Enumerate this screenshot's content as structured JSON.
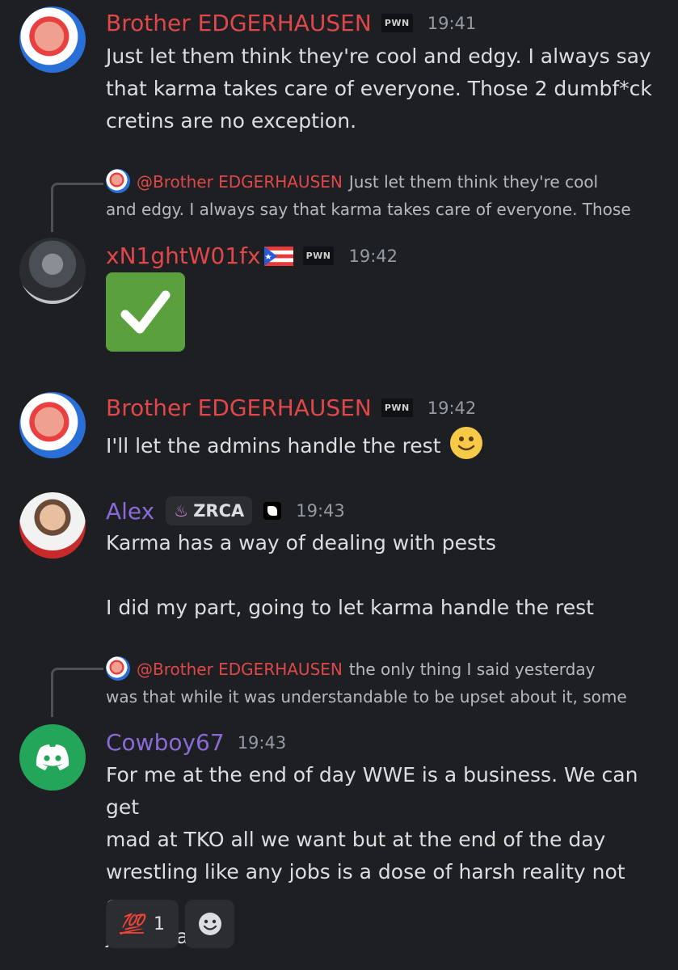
{
  "messages": [
    {
      "author": "Brother EDGERHAUSEN",
      "badge": "PWN",
      "time": "19:41",
      "lines": [
        "Just let them think they're cool and edgy. I always say",
        "that karma takes care of everyone. Those 2 dumbf*ck",
        "cretins are no exception."
      ]
    },
    {
      "reply": {
        "mention": "@Brother EDGERHAUSEN",
        "line1": "Just let them think they're cool",
        "line2": "and edgy. I always say that karma takes care of everyone. Those"
      },
      "author": "xN1ghtW01fx",
      "badge": "PWN",
      "time": "19:42",
      "content_icon": "green-checkmark-emoji"
    },
    {
      "author": "Brother EDGERHAUSEN",
      "badge": "PWN",
      "time": "19:42",
      "text": "I'll let the admins handle the rest"
    },
    {
      "author": "Alex",
      "tag": "ZRCA",
      "time": "19:43",
      "line1": "Karma has a way of dealing with pests",
      "line2": "I did my part, going to let karma handle the rest"
    },
    {
      "reply": {
        "mention": "@Brother EDGERHAUSEN",
        "line1": "the only thing I said yesterday",
        "line2": "was that while it was understandable to be upset about it, some"
      },
      "author": "Cowboy67",
      "time": "19:43",
      "lines": [
        "For me at the end of day WWE is a business. We can get",
        "mad at TKO all we want but at the end of the day",
        "wrestling like any jobs is a dose of harsh reality not every",
        "job is safe"
      ],
      "reactions": [
        {
          "emoji": "💯",
          "count": "1"
        }
      ]
    }
  ],
  "colors": {
    "background": "#1e1f22",
    "username_red": "#e0474a",
    "username_purple": "#8a6ad6",
    "timestamp": "#949ba4",
    "text": "#dbdee1"
  }
}
